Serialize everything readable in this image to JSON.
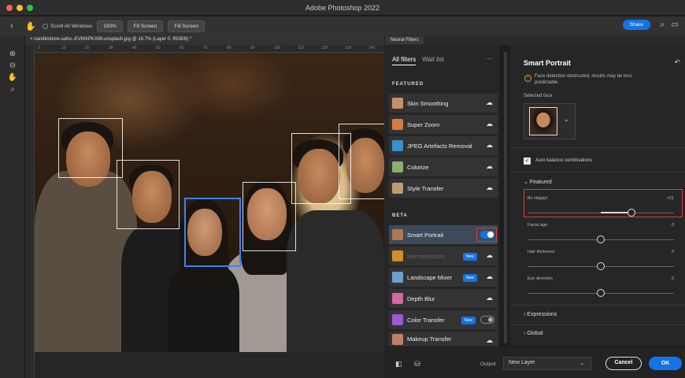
{
  "window": {
    "title": "Adobe Photoshop 2022"
  },
  "options_bar": {
    "scroll_all_windows": "Scroll All Windows",
    "zoom": "100%",
    "fit_screen": "Fit Screen",
    "fill_screen": "Fill Screen",
    "share": "Share"
  },
  "document": {
    "tab": "nandkishore-sahu--EVMXPKX8fi-unsplash.jpg @ 16.7% (Layer 0, RGB/8) *"
  },
  "ruler": {
    "ticks": [
      "0",
      "10",
      "20",
      "30",
      "40",
      "50",
      "60",
      "70",
      "80",
      "90",
      "100",
      "110",
      "120",
      "130",
      "140"
    ]
  },
  "neural_filters": {
    "panel_tab": "Neural Filters",
    "tabs": {
      "all": "All filters",
      "wait": "Wait list"
    },
    "sections": {
      "featured": "FEATURED",
      "beta": "BETA"
    },
    "featured": [
      {
        "label": "Skin Smoothing",
        "color": "#c8906a"
      },
      {
        "label": "Super Zoom",
        "color": "#d47b4a"
      },
      {
        "label": "JPEG Artefacts Removal",
        "color": "#3a8fd0"
      },
      {
        "label": "Colorize",
        "color": "#8ab070"
      },
      {
        "label": "Style Transfer",
        "color": "#c09a70"
      }
    ],
    "beta": [
      {
        "label": "Smart Portrait",
        "color": "#b07850"
      },
      {
        "label": "Harmonization",
        "color": "#d0902a",
        "badge": "New"
      },
      {
        "label": "Landscape Mixer",
        "color": "#6aa0d0",
        "badge": "New"
      },
      {
        "label": "Depth Blur",
        "color": "#d06aa0"
      },
      {
        "label": "Color Transfer",
        "color": "#9a5ad0",
        "badge": "New"
      },
      {
        "label": "Makeup Transfer",
        "color": "#c0806a"
      }
    ]
  },
  "smart_portrait": {
    "title": "Smart Portrait",
    "warning": "Face detection obstructed, results may be less predictable.",
    "selected_face_label": "Selected face",
    "auto_balance": "Auto balance combinations",
    "featured_group": "Featured",
    "sliders": [
      {
        "label": "Be Happy!",
        "value": "+21",
        "fraction": 0.71
      },
      {
        "label": "Facial age",
        "value": "0",
        "fraction": 0.5
      },
      {
        "label": "Hair thickness",
        "value": "0",
        "fraction": 0.5
      },
      {
        "label": "Eye direction",
        "value": "0",
        "fraction": 0.5
      }
    ],
    "expressions_group": "Expressions",
    "global_group": "Global"
  },
  "bottom_bar": {
    "output_label": "Output",
    "output_value": "New Layer",
    "cancel": "Cancel",
    "ok": "OK"
  },
  "colors": {
    "accent": "#1473e6",
    "highlight": "#e53935"
  }
}
